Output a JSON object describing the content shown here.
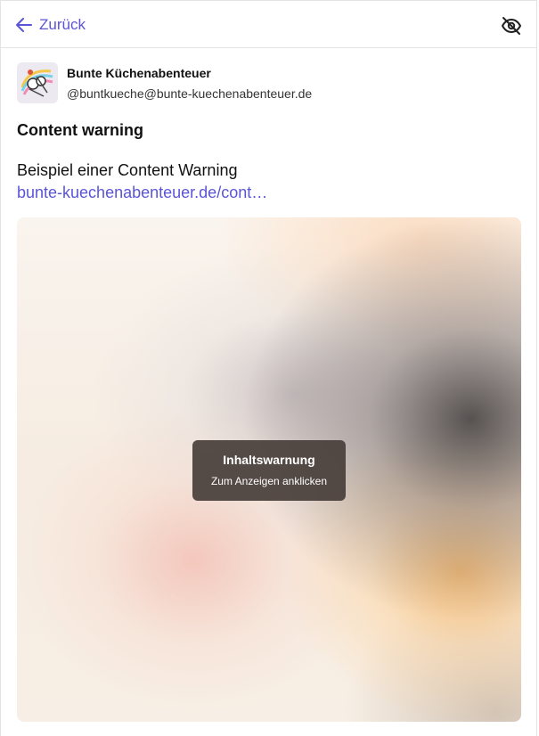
{
  "topbar": {
    "back_label": "Zurück",
    "back_icon": "arrow-left-icon",
    "hide_icon": "eye-slash-icon",
    "accent_color": "#5b55d6"
  },
  "author": {
    "display_name": "Bunte Küchenabenteuer",
    "handle": "@buntkueche@bunte-kuechenabenteuer.de",
    "avatar_icon": "avatar-image"
  },
  "post": {
    "content_warning_title": "Content warning",
    "text": "Beispiel einer Content Warning",
    "link_text": "bunte-kuechenabenteuer.de/cont…"
  },
  "media_overlay": {
    "title": "Inhaltswarnung",
    "subtitle": "Zum Anzeigen anklicken"
  }
}
